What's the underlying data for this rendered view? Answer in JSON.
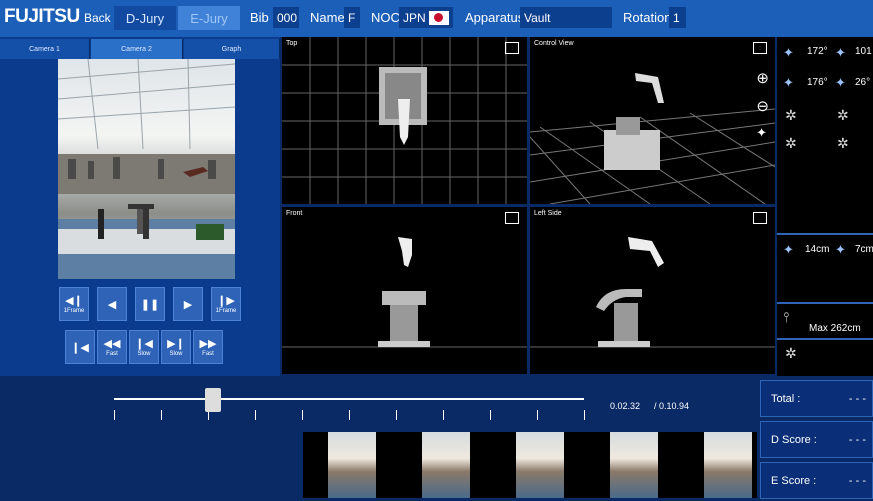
{
  "header": {
    "logo": "FUJITSU",
    "back_label": "Back",
    "tabs": [
      "D-Jury",
      "E-Jury"
    ],
    "bib_label": "Bib",
    "bib_value": "000",
    "name_label": "Name",
    "name_value": "F",
    "noc_label": "NOC",
    "noc_value": "JPN",
    "apparatus_label": "Apparatus",
    "apparatus_value": "Vault",
    "rotation_label": "Rotation",
    "rotation_value": "1"
  },
  "camera_tabs": [
    "Camera 1",
    "Camera 2",
    "Graph"
  ],
  "controls": {
    "row1": [
      {
        "icon": "step-back-icon",
        "glyph": "◀❙",
        "sub": "1Frame"
      },
      {
        "icon": "play-reverse-icon",
        "glyph": "◀",
        "sub": ""
      },
      {
        "icon": "pause-icon",
        "glyph": "❚❚",
        "sub": ""
      },
      {
        "icon": "play-icon",
        "glyph": "▶",
        "sub": ""
      },
      {
        "icon": "step-forward-icon",
        "glyph": "❙▶",
        "sub": "1Frame"
      }
    ],
    "row2": [
      {
        "icon": "skip-start-icon",
        "glyph": "❙◀",
        "sub": ""
      },
      {
        "icon": "rewind-fast-icon",
        "glyph": "◀◀",
        "sub": "Fast"
      },
      {
        "icon": "rewind-slow-icon",
        "glyph": "❙◀",
        "sub": "Slow"
      },
      {
        "icon": "forward-slow-icon",
        "glyph": "▶❙",
        "sub": "Slow"
      },
      {
        "icon": "forward-fast-icon",
        "glyph": "▶▶",
        "sub": "Fast"
      }
    ]
  },
  "viewports": {
    "top": "Top",
    "control": "Control View",
    "front": "Front",
    "left_side": "Left Side"
  },
  "measurements": {
    "angle1": "172°",
    "angle2": "101",
    "angle3": "176°",
    "angle4": "26°",
    "height1": "14cm",
    "height2": "7cm",
    "max": "Max 262cm"
  },
  "timeline": {
    "current": "0.02.32",
    "total": "/ 0.10.94",
    "progress": 0.21
  },
  "scores": {
    "total_label": "Total :",
    "total_value": "- - -",
    "d_label": "D Score :",
    "d_value": "- - -",
    "e_label": "E Score :",
    "e_value": "- - -"
  }
}
